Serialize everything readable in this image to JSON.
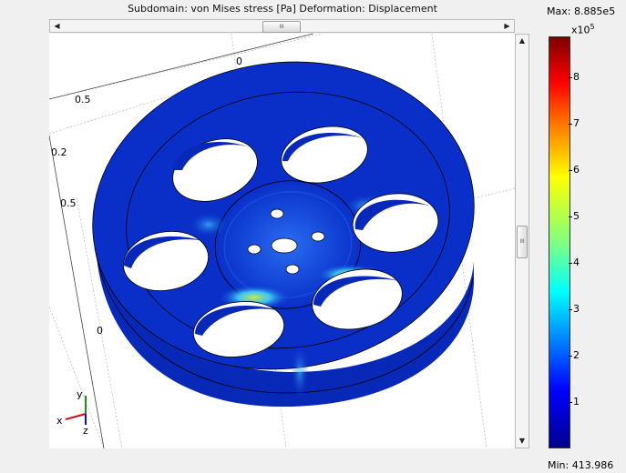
{
  "plot": {
    "title": "Subdomain: von Mises stress [Pa]   Deformation: Displacement",
    "axis_labels": [
      "0.5",
      "0.2",
      "0.5",
      "0",
      "0"
    ],
    "triad": {
      "x": "x",
      "y": "y",
      "z": "z"
    }
  },
  "scrollbars": {
    "h_grip": "III",
    "v_grip": "III",
    "left": "◀",
    "right": "▶",
    "up": "▲",
    "down": "▼"
  },
  "colorbar": {
    "max_label": "Max: 8.885e5",
    "min_label": "Min: 413.986",
    "unit_base": "x10",
    "unit_exp": "5",
    "ticks": [
      "8",
      "7",
      "6",
      "5",
      "4",
      "3",
      "2",
      "1"
    ],
    "tick_values": [
      8,
      7,
      6,
      5,
      4,
      3,
      2,
      1
    ],
    "range": [
      0.00413986,
      8.885
    ]
  },
  "colors": {
    "wheel_blue": "#0a2fc8",
    "wheel_dark": "#061f9e",
    "hotspot_cyan": "#3fd0ff",
    "hotspot_yellow": "#d8ff40"
  }
}
